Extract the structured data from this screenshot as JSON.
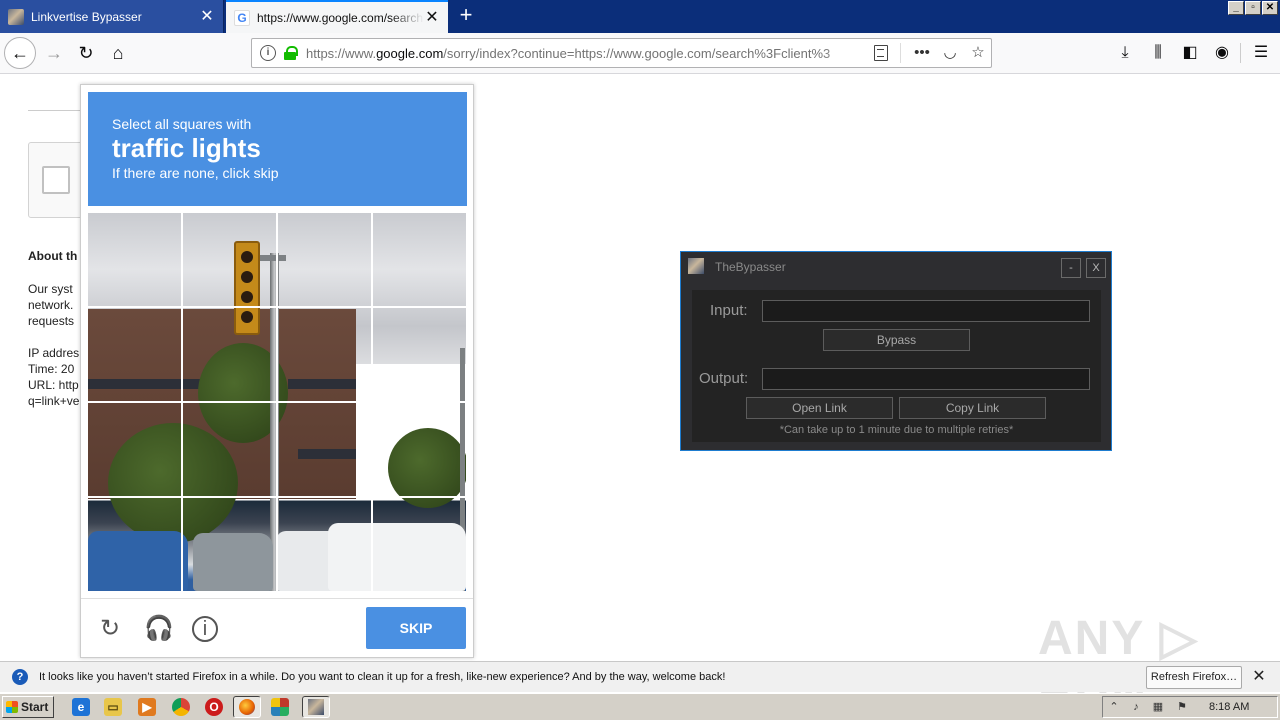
{
  "browser": {
    "tabs": [
      {
        "label": "Linkvertise Bypasser",
        "favicon": "bypasser-avatar-icon"
      },
      {
        "label": "https://www.google.com/search?c",
        "favicon": "google-g-icon"
      }
    ],
    "new_tab": "+",
    "url_prefix": "https://www.",
    "url_domain": "google.com",
    "url_rest": "/sorry/index?continue=https://www.google.com/search%3Fclient%3",
    "window_controls": [
      "_",
      "▫",
      "✕"
    ],
    "accent": "#0a84ff"
  },
  "page": {
    "about_heading": "About th",
    "para1": [
      "Our syst",
      "network.",
      "requests"
    ],
    "para2": [
      "IP addres",
      "Time: 20",
      "URL: http",
      "q=link+ve"
    ]
  },
  "captcha": {
    "instruction_line1": "Select all squares with",
    "instruction_target": "traffic lights",
    "instruction_line3": "If there are none, click skip",
    "skip_label": "SKIP",
    "header_color": "#4a90e2",
    "footer_icons": [
      "reload-icon",
      "audio-headphones-icon",
      "info-icon"
    ]
  },
  "bypasser": {
    "title": "TheBypasser",
    "minimize": "-",
    "close": "X",
    "input_label": "Input:",
    "input_value": "",
    "bypass_label": "Bypass",
    "output_label": "Output:",
    "output_value": "",
    "open_link_label": "Open Link",
    "copy_link_label": "Copy Link",
    "note": "*Can take up to 1 minute due to multiple retries*"
  },
  "notification": {
    "message": "It looks like you haven’t started Firefox in a while. Do you want to clean it up for a fresh, like-new experience? And by the way, welcome back!",
    "button_label": "Refresh Firefox…",
    "close": "✕"
  },
  "watermark": "ANY ▷ RUN",
  "taskbar": {
    "start_label": "Start",
    "clock": "8:18 AM"
  }
}
